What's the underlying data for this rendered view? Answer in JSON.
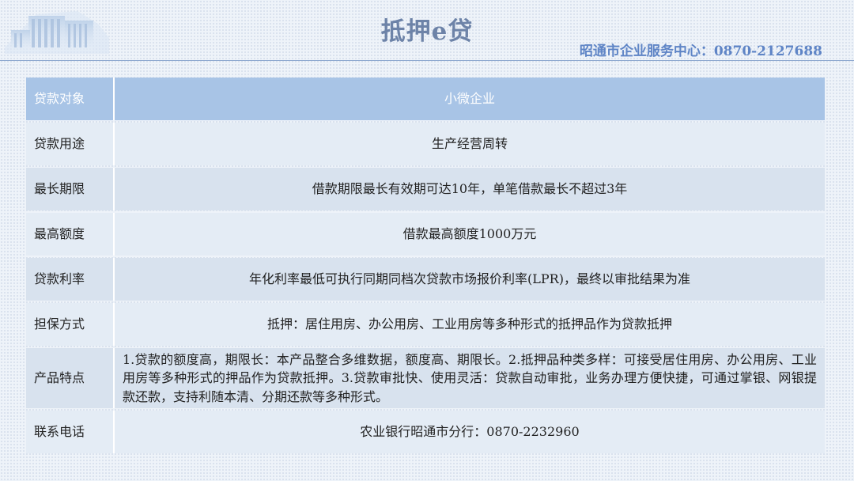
{
  "header": {
    "title": "抵押e贷",
    "hotline": "昭通市企业服务中心：0870-2127688"
  },
  "table": {
    "rows": [
      {
        "label": "贷款对象",
        "value": "小微企业"
      },
      {
        "label": "贷款用途",
        "value": "生产经营周转"
      },
      {
        "label": "最长期限",
        "value": "借款期限最长有效期可达10年，单笔借款最长不超过3年"
      },
      {
        "label": "最高额度",
        "value": "借款最高额度1000万元"
      },
      {
        "label": "贷款利率",
        "value": "年化利率最低可执行同期同档次贷款市场报价利率(LPR)，最终以审批结果为准"
      },
      {
        "label": "担保方式",
        "value": "抵押：居住用房、办公用房、工业用房等多种形式的抵押品作为贷款抵押"
      },
      {
        "label": "产品特点",
        "value": "1.贷款的额度高，期限长：本产品整合多维数据，额度高、期限长。2.抵押品种类多样：可接受居住用房、办公用房、工业用房等多种形式的押品作为贷款抵押。3.贷款审批快、使用灵活：贷款自动审批，业务办理方便快捷，可通过掌银、网银提款还款，支持利随本清、分期还款等多种形式。"
      },
      {
        "label": "联系电话",
        "value": "农业银行昭通市分行：0870-2232960"
      }
    ]
  },
  "colors": {
    "header_row": "#a8c4e6",
    "title": "#6d83a8",
    "hotline": "#5f85c6",
    "row_light": "#e4ecf5",
    "row_dark": "#d8e2ee"
  },
  "icons": {
    "logo": "building-logo-icon"
  }
}
